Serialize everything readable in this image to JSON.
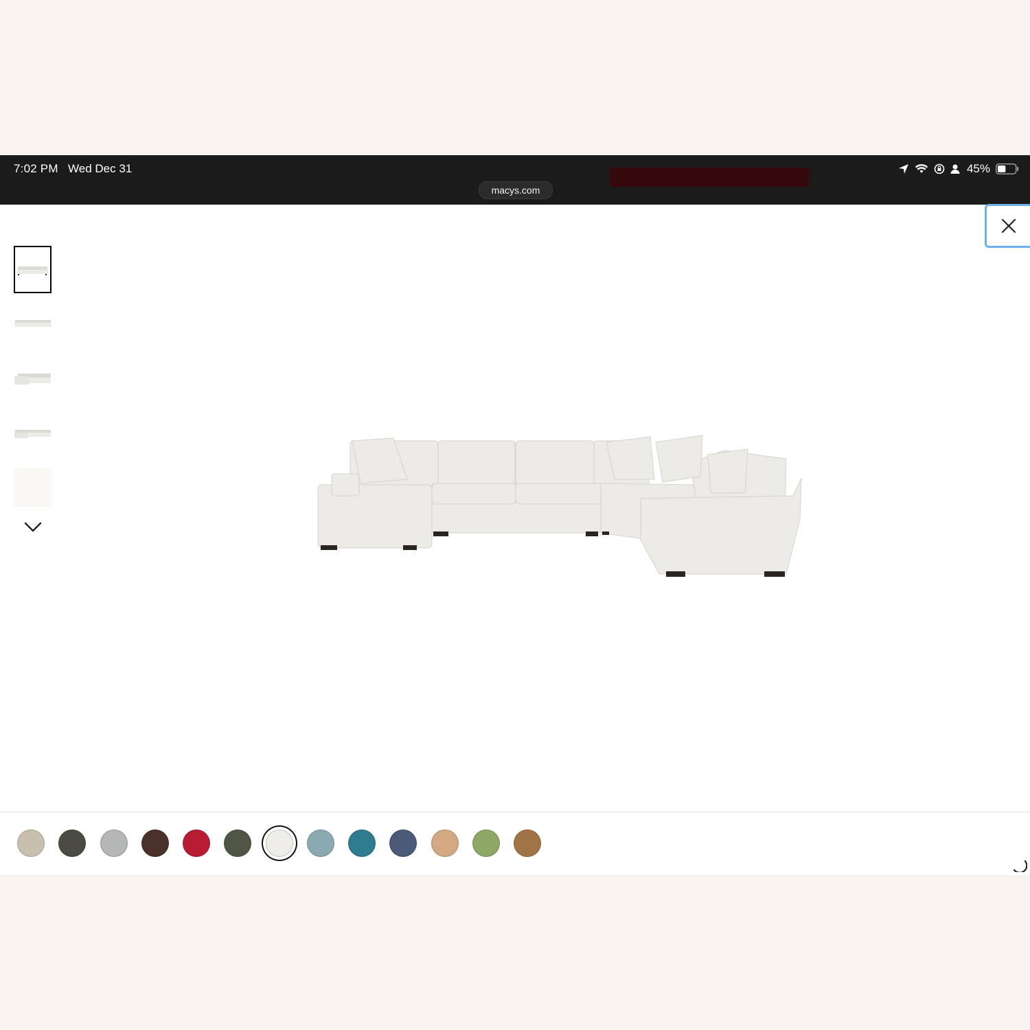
{
  "status_bar": {
    "time": "7:02 PM",
    "date": "Wed Dec 31",
    "url": "macys.com",
    "battery": "45%",
    "battery_level": 0.45,
    "icons": [
      "location-arrow-icon",
      "wifi-icon",
      "orientation-lock-icon",
      "person-icon",
      "battery-icon"
    ]
  },
  "viewer": {
    "close_icon": "close-icon",
    "thumbnails_count_visible": 5,
    "selected_thumbnail": 1,
    "scroll_down_icon": "chevron-down-icon"
  },
  "swatches": {
    "colors": [
      "#c9bfae",
      "#4b4b44",
      "#b4b6b8",
      "#4a3129",
      "#b81c35",
      "#4f5645",
      "#efede8",
      "#8aa9b0",
      "#2e7c8e",
      "#4a5a78",
      "#d2a982",
      "#8ea866",
      "#a07447"
    ],
    "selected_index": 6
  },
  "loading_icon": "spinner-icon"
}
